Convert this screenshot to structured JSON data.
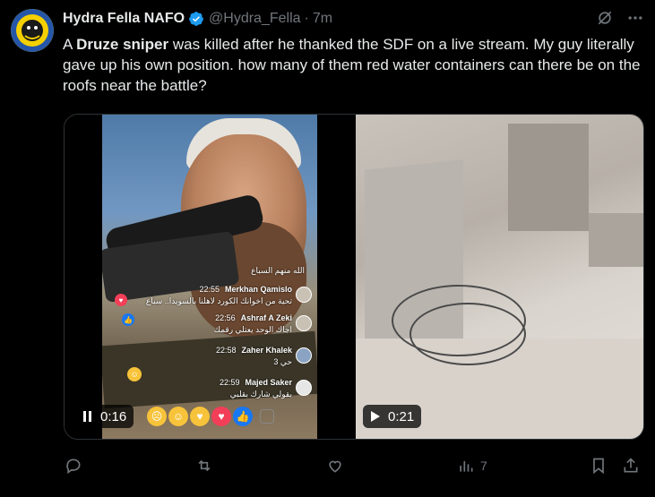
{
  "tweet": {
    "author_name": "Hydra Fella NAFO",
    "handle": "@Hydra_Fella",
    "separator": "·",
    "time": "7m",
    "text_prefix": "A ",
    "text_bold": "Druze sniper",
    "text_rest": " was killed after he thanked the SDF on a live stream. My guy literally gave up his own position. how many of them red water containers can there be on the roofs near the battle?"
  },
  "media": {
    "left_video": {
      "duration": "0:16",
      "comments": [
        {
          "time": "",
          "name": "",
          "text": "الله منهم السباع"
        },
        {
          "time": "22:55",
          "name": "Merkhan Qamislo",
          "text": "تحية من اخوانك الكورد لاهلنا بالسويدا.. سباع"
        },
        {
          "time": "22:56",
          "name": "Ashraf A Zeki",
          "text": "اجاك الوحد يعتلي رقمك"
        },
        {
          "time": "22:58",
          "name": "Zaher Khalek",
          "text": "حي 3"
        },
        {
          "time": "22:59",
          "name": "Majed Saker",
          "text": "بقولي شارك بقلبي"
        }
      ]
    },
    "right_video": {
      "duration": "0:21"
    }
  },
  "actions": {
    "views": "7"
  },
  "colors": {
    "background": "#000000",
    "text": "#e7e9ea",
    "muted": "#71767b",
    "verified": "#1d9bf0"
  },
  "icons": [
    "grok-icon",
    "more-icon",
    "reply-icon",
    "retweet-icon",
    "like-icon",
    "views-icon",
    "bookmark-icon",
    "share-icon",
    "verified-icon",
    "play-icon",
    "pause-icon"
  ]
}
